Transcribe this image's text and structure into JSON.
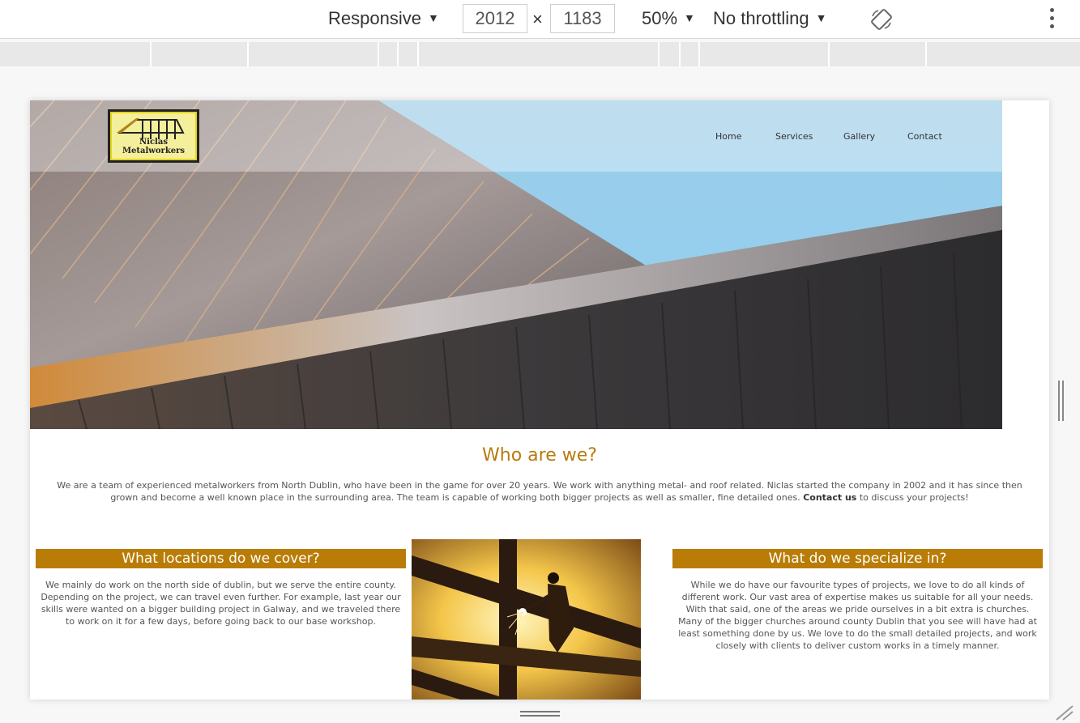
{
  "devtools": {
    "device_mode": "Responsive",
    "width": "2012",
    "height": "1183",
    "dim_separator": "×",
    "zoom": "50%",
    "throttling": "No throttling",
    "caret": "▼",
    "icons": {
      "rotate": "rotate-icon",
      "menu": "more-vert-icon"
    }
  },
  "site": {
    "logo_text": "Niclas Metalworkers",
    "nav": [
      "Home",
      "Services",
      "Gallery",
      "Contact"
    ],
    "who_title": "Who are we?",
    "intro_before": "We are a team of experienced metalworkers from North Dublin, who have been in the game for over 20 years. We work with anything metal- and roof related. Niclas started the company in 2002 and it has since then grown and become a well known place in the surrounding area. The team is capable of working both bigger projects as well as smaller, fine detailed ones. ",
    "intro_link": "Contact us",
    "intro_after": " to discuss your projects!",
    "left_title": "What locations do we cover?",
    "left_text": "We mainly do work on the north side of dublin, but we serve the entire county. Depending on the project, we can travel even further. For example, last year our skills were wanted on a bigger building project in Galway, and we traveled there to work on it for a few days, before going back to our base workshop.",
    "right_title": "What do we specialize in?",
    "right_text": "While we do have our favourite types of projects, we love to do all kinds of different work. Our vast area of expertise makes us suitable for all your needs. With that said, one of the areas we pride ourselves in a bit extra is churches. Many of the bigger churches around county Dublin that you see will have had at least something done by us. We love to do the small detailed projects, and work closely with clients to deliver custom works in a timely manner."
  },
  "colors": {
    "accent": "#b97c06",
    "heading": "#b87b0d",
    "text": "#555555"
  }
}
